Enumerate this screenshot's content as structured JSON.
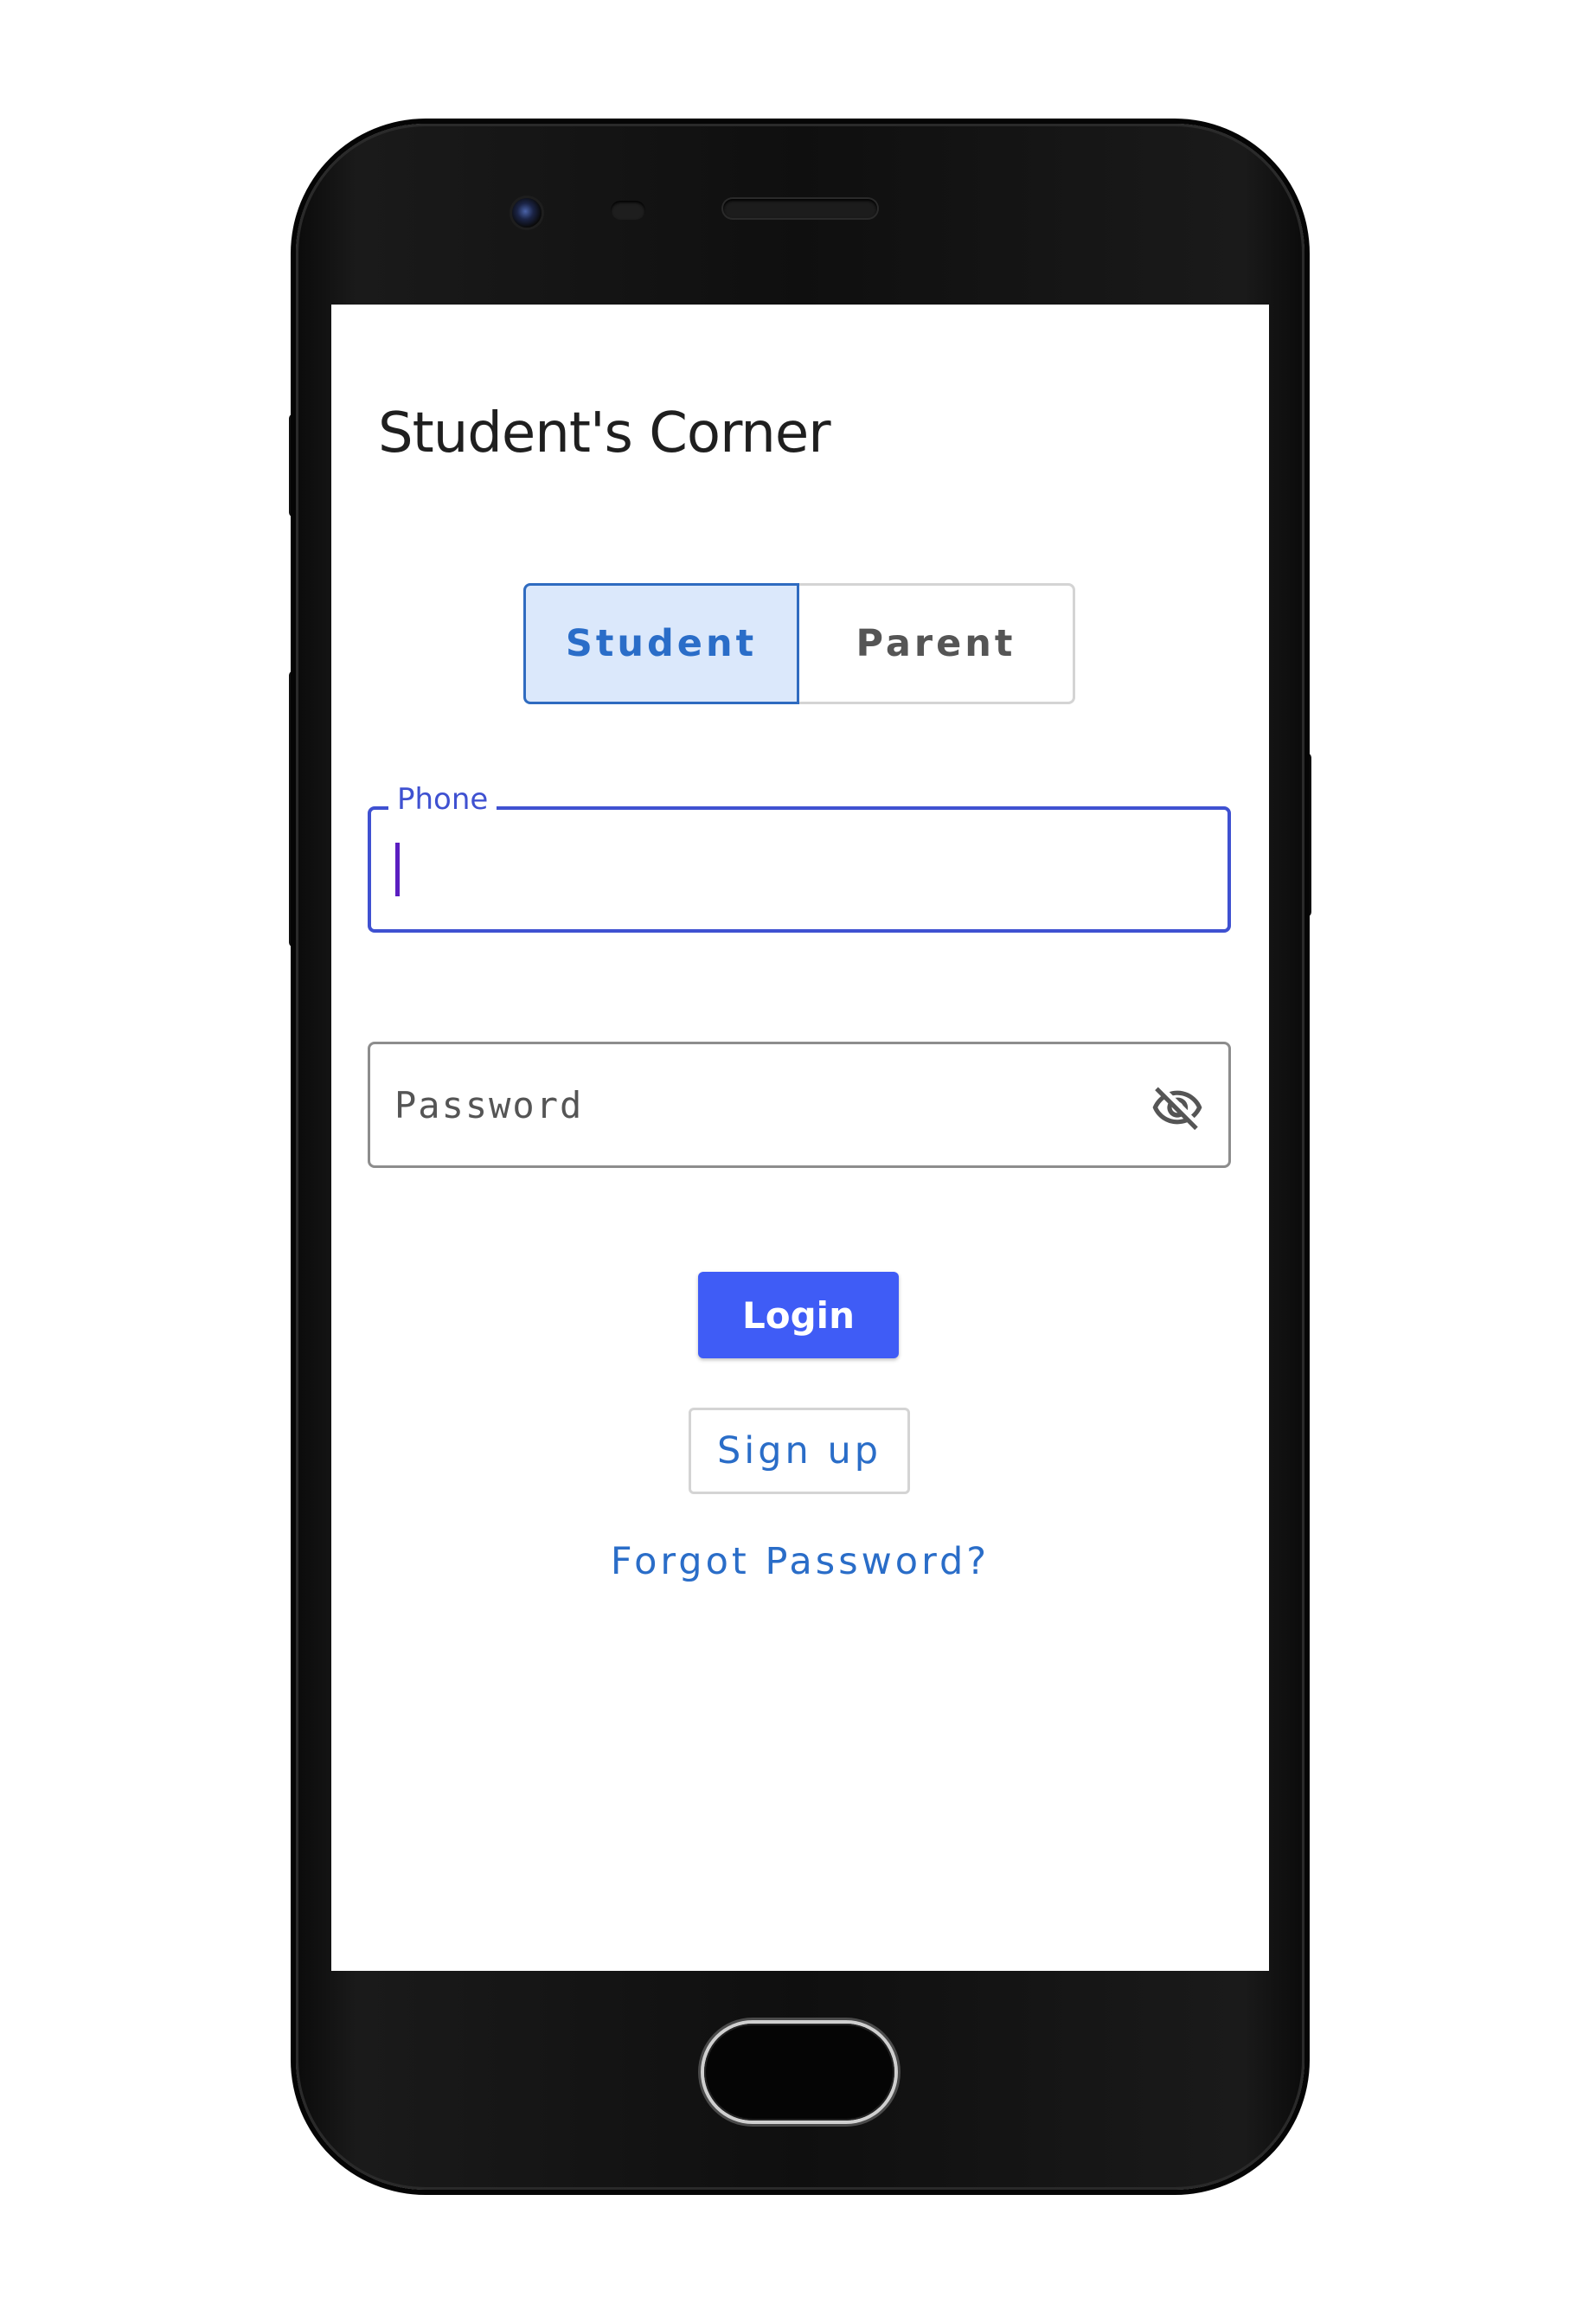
{
  "app": {
    "title": "Student's Corner"
  },
  "role_toggle": {
    "options": [
      {
        "label": "Student",
        "selected": true
      },
      {
        "label": "Parent",
        "selected": false
      }
    ]
  },
  "form": {
    "phone": {
      "label": "Phone",
      "value": ""
    },
    "password": {
      "placeholder": "Password",
      "value": "",
      "visibility_icon": "eye-off-icon"
    }
  },
  "actions": {
    "login_label": "Login",
    "signup_label": "Sign up",
    "forgot_label": "Forgot Password?"
  },
  "colors": {
    "accent": "#3f5cf6",
    "link": "#2a6dc8",
    "focus": "#3f51d1",
    "selected_bg": "#dbe8fb"
  }
}
